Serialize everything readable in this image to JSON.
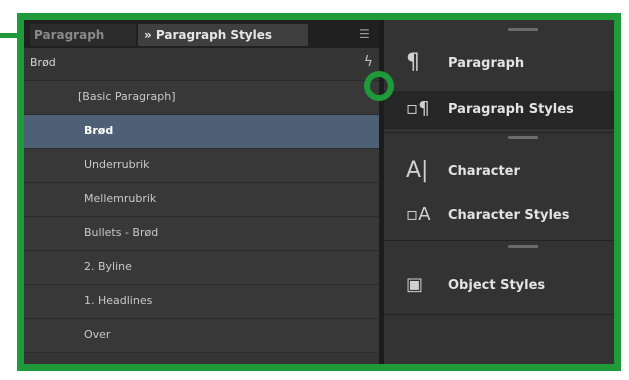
{
  "tabs": {
    "inactive": "Paragraph",
    "active": "» Paragraph Styles",
    "menu_icon": "panel-menu-icon"
  },
  "current_style": "Brød",
  "styles": [
    {
      "label": "[Basic Paragraph]"
    },
    {
      "label": "Brød",
      "selected": true
    },
    {
      "label": "Underrubrik"
    },
    {
      "label": "Mellemrubrik"
    },
    {
      "label": "Bullets - Brød"
    },
    {
      "label": "2. Byline"
    },
    {
      "label": "1. Headlines"
    },
    {
      "label": "Over"
    }
  ],
  "dock": {
    "paragraph": "Paragraph",
    "paragraph_styles": "Paragraph Styles",
    "character": "Character",
    "character_styles": "Character Styles",
    "object_styles": "Object Styles"
  },
  "colors": {
    "highlight": "#1f9a3a",
    "selection": "#4d6076"
  }
}
